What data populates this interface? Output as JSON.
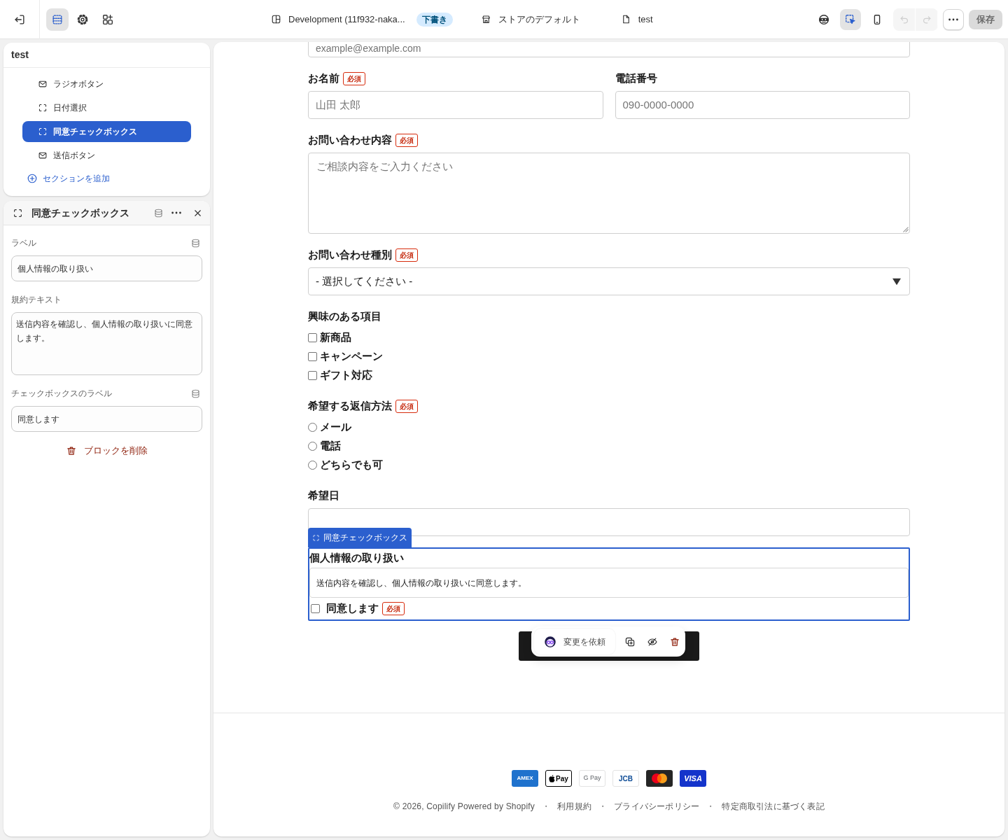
{
  "topbar": {
    "tools": [
      {
        "kind": "sections",
        "selected": true
      },
      {
        "kind": "settings",
        "selected": false
      },
      {
        "kind": "apps",
        "selected": false
      }
    ],
    "theme": {
      "name": "Development (11f932-naka...",
      "badge": "下書き"
    },
    "store": {
      "label": "ストアのデフォルト"
    },
    "page": {
      "label": "test"
    },
    "view_tools": [
      {
        "kind": "preview_as",
        "selected": false
      },
      {
        "kind": "inspector",
        "selected": true
      },
      {
        "kind": "mobile",
        "selected": false
      }
    ],
    "history": [
      {
        "kind": "undo",
        "disabled": true
      },
      {
        "kind": "redo",
        "disabled": true
      }
    ],
    "save": {
      "label": "保存",
      "disabled": true
    }
  },
  "sidebar": {
    "title": "test",
    "items": [
      {
        "kind": "mail",
        "label": "ラジオボタン",
        "selected": false
      },
      {
        "kind": "block",
        "label": "日付選択",
        "selected": false
      },
      {
        "kind": "block",
        "label": "同意チェックボックス",
        "selected": true
      },
      {
        "kind": "mail",
        "label": "送信ボタン",
        "selected": false
      }
    ],
    "add_label": "セクションを追加"
  },
  "settings_panel": {
    "title": "同意チェックボックス",
    "fields": [
      {
        "kind": "text",
        "label": "ラベル",
        "value": "個人情報の取り扱い",
        "dynamic_source": true
      },
      {
        "kind": "textarea",
        "label": "規約テキスト",
        "value": "送信内容を確認し、個人情報の取り扱いに同意します。",
        "dynamic_source": false
      },
      {
        "kind": "text",
        "label": "チェックボックスのラベル",
        "value": "同意します",
        "dynamic_source": true
      }
    ],
    "delete_label": "ブロックを削除"
  },
  "preview": {
    "email_field": {
      "placeholder": "example@example.com"
    },
    "fields": [
      {
        "kind": "pair",
        "items": [
          {
            "label": "お名前",
            "badge": "必須",
            "placeholder": "山田 太郎"
          },
          {
            "label": "電話番号",
            "placeholder": "090-0000-0000"
          }
        ]
      },
      {
        "kind": "textarea",
        "label": "お問い合わせ内容",
        "badge": "必須",
        "placeholder": "ご相談内容をご入力ください"
      },
      {
        "kind": "select",
        "label": "お問い合わせ種別",
        "badge": "必須",
        "value": "- 選択してください -"
      },
      {
        "kind": "checkboxes",
        "label": "興味のある項目",
        "options": [
          {
            "label": "新商品",
            "checked": false
          },
          {
            "label": "キャンペーン",
            "checked": false
          },
          {
            "label": "ギフト対応",
            "checked": false
          }
        ]
      },
      {
        "kind": "radios",
        "label": "希望する返信方法",
        "badge": "必須",
        "options": [
          {
            "label": "メール",
            "selected": false
          },
          {
            "label": "電話",
            "selected": false
          },
          {
            "label": "どちらでも可",
            "selected": false
          }
        ]
      },
      {
        "kind": "date",
        "label": "希望日"
      }
    ],
    "selected_block": {
      "tag": "同意チェックボックス",
      "heading": "個人情報の取り扱い",
      "terms": "送信内容を確認し、個人情報の取り扱いに同意します。",
      "checkbox_label": "同意します",
      "checked": false,
      "badge": "必須"
    },
    "block_toolbar": {
      "request_label": "変更を依頼"
    },
    "payment_methods": [
      {
        "kind": "amex",
        "text": "AMEX"
      },
      {
        "kind": "apple_pay",
        "text": "Pay"
      },
      {
        "kind": "google_pay",
        "text": "G Pay"
      },
      {
        "kind": "jcb",
        "text": "JCB"
      },
      {
        "kind": "mastercard"
      },
      {
        "kind": "visa",
        "text": "VISA"
      }
    ],
    "footer": {
      "copyright": "© 2026, Copilify Powered by Shopify",
      "links": [
        {
          "separator": "・",
          "label": "利用規約"
        },
        {
          "separator": "・",
          "label": "プライバシーポリシー"
        },
        {
          "separator": "・",
          "label": "特定商取引法に基づく表記"
        }
      ]
    }
  }
}
